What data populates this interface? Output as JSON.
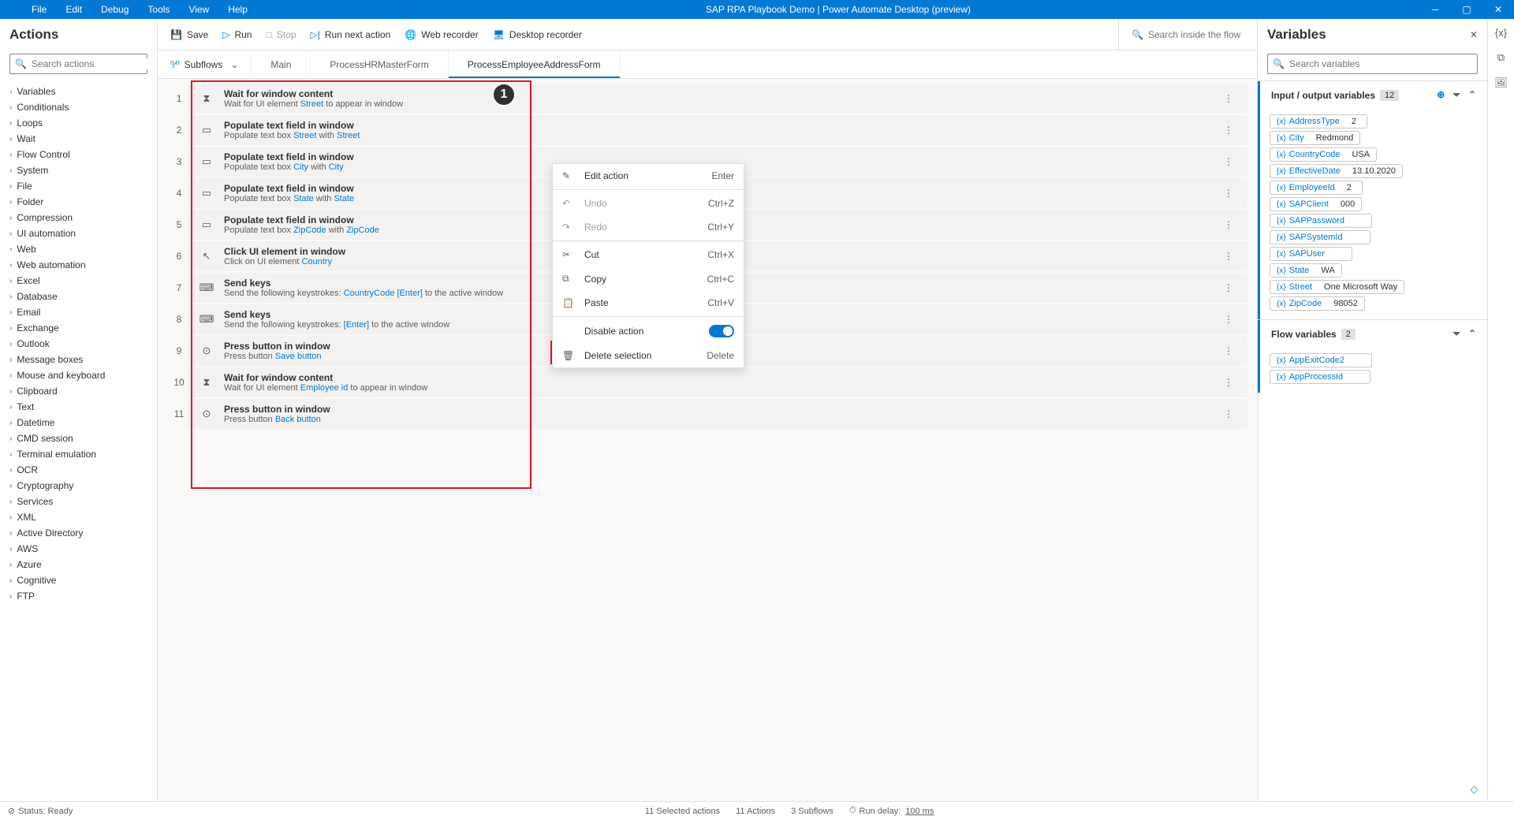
{
  "title": "SAP RPA Playbook Demo | Power Automate Desktop (preview)",
  "menu": [
    "File",
    "Edit",
    "Debug",
    "Tools",
    "View",
    "Help"
  ],
  "actions_panel": {
    "title": "Actions",
    "search_placeholder": "Search actions",
    "tree": [
      "Variables",
      "Conditionals",
      "Loops",
      "Wait",
      "Flow Control",
      "System",
      "File",
      "Folder",
      "Compression",
      "UI automation",
      "Web",
      "Web automation",
      "Excel",
      "Database",
      "Email",
      "Exchange",
      "Outlook",
      "Message boxes",
      "Mouse and keyboard",
      "Clipboard",
      "Text",
      "Datetime",
      "CMD session",
      "Terminal emulation",
      "OCR",
      "Cryptography",
      "Services",
      "XML",
      "Active Directory",
      "AWS",
      "Azure",
      "Cognitive",
      "FTP"
    ]
  },
  "toolbar": {
    "save": "Save",
    "run": "Run",
    "stop": "Stop",
    "run_next": "Run next action",
    "web_recorder": "Web recorder",
    "desktop_recorder": "Desktop recorder",
    "search_placeholder": "Search inside the flow"
  },
  "subflows_label": "Subflows",
  "tabs": [
    {
      "label": "Main",
      "active": false
    },
    {
      "label": "ProcessHRMasterForm",
      "active": false
    },
    {
      "label": "ProcessEmployeeAddressForm",
      "active": true
    }
  ],
  "steps": [
    {
      "n": 1,
      "icon": "⧗",
      "title": "Wait for window content",
      "desc_pre": "Wait for UI element ",
      "link1": "Street",
      "desc_mid": " to appear in window"
    },
    {
      "n": 2,
      "icon": "▭",
      "title": "Populate text field in window",
      "desc_pre": "Populate text box ",
      "link1": "Street",
      "desc_mid": " with   ",
      "link2": "Street"
    },
    {
      "n": 3,
      "icon": "▭",
      "title": "Populate text field in window",
      "desc_pre": "Populate text box ",
      "link1": "City",
      "desc_mid": " with   ",
      "link2": "City"
    },
    {
      "n": 4,
      "icon": "▭",
      "title": "Populate text field in window",
      "desc_pre": "Populate text box ",
      "link1": "State",
      "desc_mid": " with   ",
      "link2": "State"
    },
    {
      "n": 5,
      "icon": "▭",
      "title": "Populate text field in window",
      "desc_pre": "Populate text box ",
      "link1": "ZipCode",
      "desc_mid": " with   ",
      "link2": "ZipCode"
    },
    {
      "n": 6,
      "icon": "↖",
      "title": "Click UI element in window",
      "desc_pre": "Click on UI element ",
      "link1": "Country"
    },
    {
      "n": 7,
      "icon": "⌨",
      "title": "Send keys",
      "desc_pre": "Send the following keystrokes:   ",
      "link1": "CountryCode",
      "desc_mid": "  ",
      "link2": "[Enter]",
      "desc_post": " to the active window"
    },
    {
      "n": 8,
      "icon": "⌨",
      "title": "Send keys",
      "desc_pre": "Send the following keystrokes: ",
      "link1": "[Enter]",
      "desc_mid": " to the active window"
    },
    {
      "n": 9,
      "icon": "⊙",
      "title": "Press button in window",
      "desc_pre": "Press button ",
      "link1": "Save button"
    },
    {
      "n": 10,
      "icon": "⧗",
      "title": "Wait for window content",
      "desc_pre": "Wait for UI element ",
      "link1": "Employee id",
      "desc_mid": " to appear in window"
    },
    {
      "n": 11,
      "icon": "⊙",
      "title": "Press button in window",
      "desc_pre": "Press button ",
      "link1": "Back button"
    }
  ],
  "context_menu": {
    "edit": "Edit action",
    "edit_key": "Enter",
    "undo": "Undo",
    "undo_key": "Ctrl+Z",
    "redo": "Redo",
    "redo_key": "Ctrl+Y",
    "cut": "Cut",
    "cut_key": "Ctrl+X",
    "copy": "Copy",
    "copy_key": "Ctrl+C",
    "paste": "Paste",
    "paste_key": "Ctrl+V",
    "disable": "Disable action",
    "delete": "Delete selection",
    "delete_key": "Delete"
  },
  "variables_panel": {
    "title": "Variables",
    "search_placeholder": "Search variables",
    "io_title": "Input / output variables",
    "io_count": "12",
    "flow_title": "Flow variables",
    "flow_count": "2",
    "io_vars": [
      {
        "name": "AddressType",
        "value": "2"
      },
      {
        "name": "City",
        "value": "Redmond"
      },
      {
        "name": "CountryCode",
        "value": "USA"
      },
      {
        "name": "EffectiveDate",
        "value": "13.10.2020"
      },
      {
        "name": "EmployeeId",
        "value": "2"
      },
      {
        "name": "SAPClient",
        "value": "000"
      },
      {
        "name": "SAPPassword",
        "value": ""
      },
      {
        "name": "SAPSystemId",
        "value": ""
      },
      {
        "name": "SAPUser",
        "value": ""
      },
      {
        "name": "State",
        "value": "WA"
      },
      {
        "name": "Street",
        "value": "One Microsoft Way"
      },
      {
        "name": "ZipCode",
        "value": "98052"
      }
    ],
    "flow_vars": [
      {
        "name": "AppExitCode2",
        "value": ""
      },
      {
        "name": "AppProcessId",
        "value": ""
      }
    ]
  },
  "statusbar": {
    "status": "Status: Ready",
    "selected": "11 Selected actions",
    "actions": "11 Actions",
    "subflows": "3 Subflows",
    "delay_label": "Run delay:",
    "delay_value": "100 ms"
  }
}
